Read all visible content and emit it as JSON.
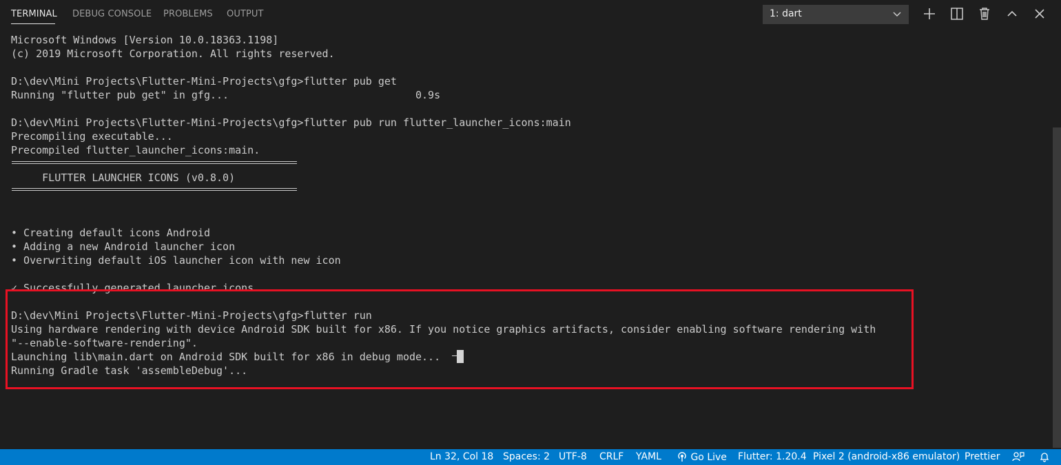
{
  "panel": {
    "tabs": [
      {
        "label": "TERMINAL",
        "active": true
      },
      {
        "label": "DEBUG CONSOLE"
      },
      {
        "label": "PROBLEMS"
      },
      {
        "label": "OUTPUT"
      }
    ],
    "terminal_select": {
      "value": "1: dart"
    },
    "actions": [
      "plus-icon",
      "split-icon",
      "trash-icon",
      "chevron-up-icon",
      "close-icon"
    ]
  },
  "terminal": {
    "lines": [
      "Microsoft Windows [Version 10.0.18363.1198]",
      "(c) 2019 Microsoft Corporation. All rights reserved.",
      "",
      "D:\\dev\\Mini Projects\\Flutter-Mini-Projects\\gfg>flutter pub get",
      "Running \"flutter pub get\" in gfg...                              0.9s",
      "",
      "D:\\dev\\Mini Projects\\Flutter-Mini-Projects\\gfg>flutter pub run flutter_launcher_icons:main",
      "Precompiling executable...",
      "Precompiled flutter_launcher_icons:main.",
      "",
      "     FLUTTER LAUNCHER ICONS (v0.8.0)",
      "",
      "",
      "",
      "• Creating default icons Android",
      "• Adding a new Android launcher icon",
      "• Overwriting default iOS launcher icon with new icon",
      "",
      "✓ Successfully generated launcher icons",
      "",
      "D:\\dev\\Mini Projects\\Flutter-Mini-Projects\\gfg>flutter run",
      "Using hardware rendering with device Android SDK built for x86. If you notice graphics artifacts, consider enabling software rendering with",
      "\"--enable-software-rendering\".",
      "Launching lib\\main.dart on Android SDK built for x86 in debug mode...",
      "Running Gradle task 'assembleDebug'..."
    ],
    "highlight_color": "#e81123"
  },
  "statusbar": {
    "color": "#007acc",
    "items": [
      {
        "label": "Ln 32, Col 18"
      },
      {
        "label": "Spaces: 2"
      },
      {
        "label": "UTF-8"
      },
      {
        "label": "CRLF"
      },
      {
        "label": "YAML"
      },
      {
        "label": "Go Live",
        "icon": "broadcast-icon"
      },
      {
        "label": "Flutter: 1.20.4"
      },
      {
        "label": "Pixel 2 (android-x86 emulator)"
      },
      {
        "label": "Prettier"
      }
    ],
    "right_icons": [
      "feedback-icon",
      "bell-icon"
    ]
  }
}
